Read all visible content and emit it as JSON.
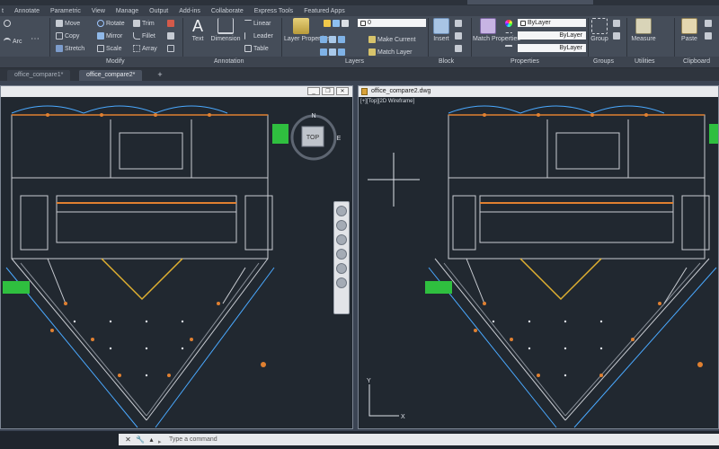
{
  "ribbon_tabs": [
    "t",
    "Annotate",
    "Parametric",
    "View",
    "Manage",
    "Output",
    "Add-ins",
    "Collaborate",
    "Express Tools",
    "Featured Apps"
  ],
  "draw": {
    "arc": "Arc"
  },
  "modify": {
    "move": "Move",
    "rotate": "Rotate",
    "trim": "Trim",
    "copy": "Copy",
    "mirror": "Mirror",
    "fillet": "Fillet",
    "stretch": "Stretch",
    "scale": "Scale",
    "array": "Array"
  },
  "annotation": {
    "text": "Text",
    "dimension": "Dimension",
    "linear": "Linear",
    "leader": "Leader",
    "table": "Table"
  },
  "layers": {
    "layer_properties": "Layer Properties",
    "make_current": "Make Current",
    "match_layer": "Match Layer",
    "current_layer": "0"
  },
  "block": {
    "insert": "Insert"
  },
  "properties": {
    "match_properties": "Match Properties",
    "color": "ByLayer",
    "linetype": "ByLayer",
    "lineweight": "ByLayer"
  },
  "groups": {
    "group": "Group"
  },
  "utilities": {
    "measure": "Measure"
  },
  "clipboard": {
    "paste": "Paste"
  },
  "panel_titles": {
    "modify": "Modify",
    "annotation": "Annotation",
    "layers": "Layers",
    "block": "Block",
    "properties": "Properties",
    "groups": "Groups",
    "utilities": "Utilities",
    "clipboard": "Clipboard"
  },
  "doc_tabs": [
    "office_compare1*",
    "office_compare2*"
  ],
  "viewports": {
    "left": {
      "title": "",
      "label": ""
    },
    "right": {
      "title": "office_compare2.dwg",
      "label": "[+][Top][2D Wireframe]"
    }
  },
  "viewcube": {
    "face": "TOP",
    "north": "N",
    "east": "E"
  },
  "ucs": {
    "y": "Y",
    "x": "X"
  },
  "command": {
    "placeholder": "Type a command"
  },
  "colors": {
    "background": "#212830",
    "walls": "#c9ccd2",
    "accent_orange": "#e08030",
    "accent_green": "#2fbf3f",
    "accent_blue": "#4aa9ff"
  }
}
